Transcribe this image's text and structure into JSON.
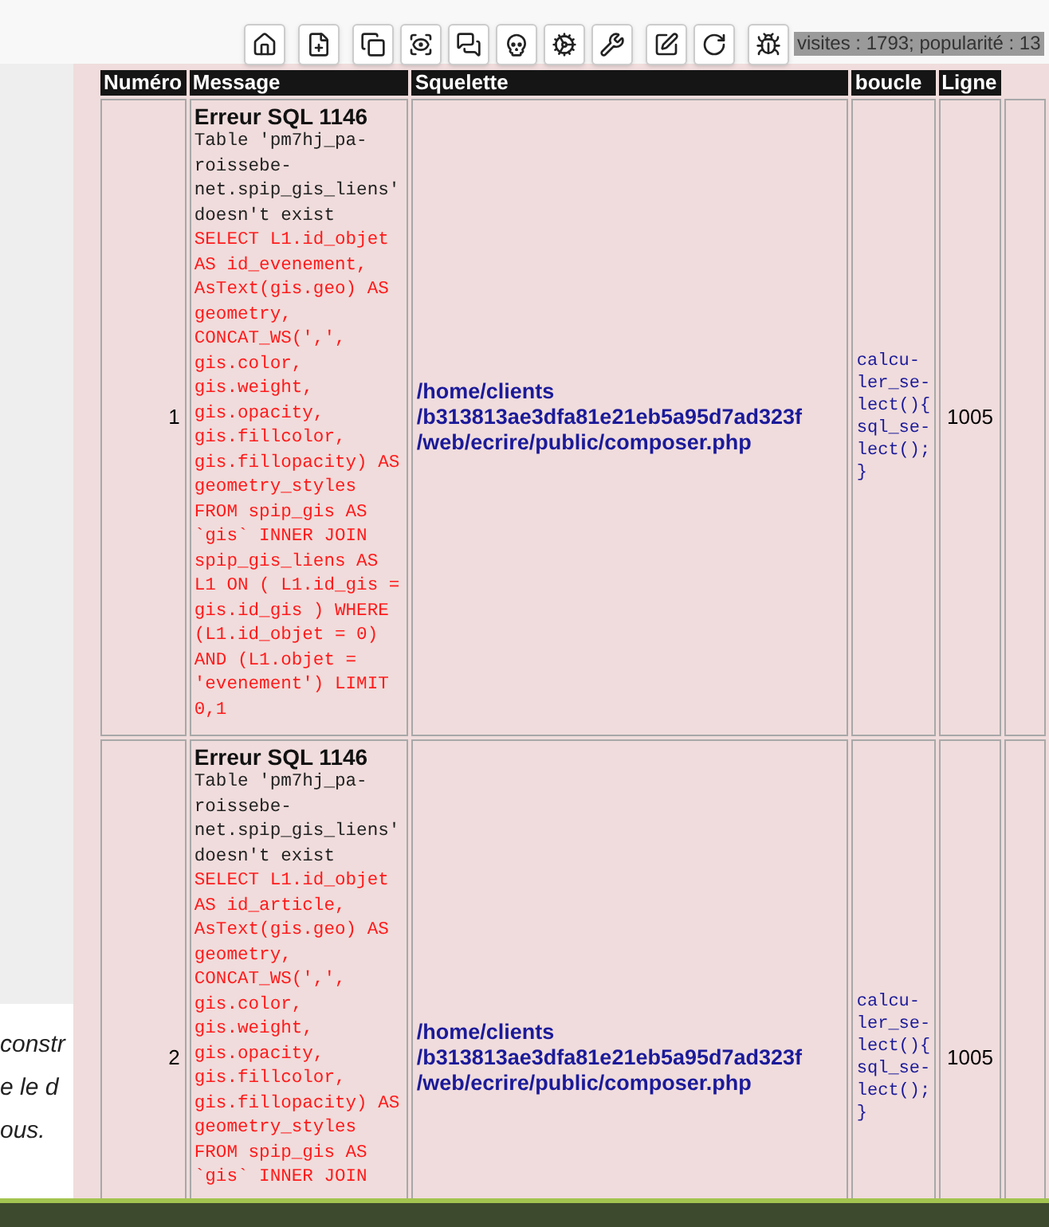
{
  "stats": "visites : 1793; popularité : 13",
  "background_text": [
    "constr",
    "e le d",
    "ous."
  ],
  "table": {
    "columns": [
      "Numéro",
      "Message",
      "Squelette",
      "boucle",
      "Ligne"
    ],
    "rows": [
      {
        "number": "1",
        "error_title": "Erreur SQL 1146",
        "error_text": "Table 'pm7hj_pa-roissebe-net.spip_gis_liens' doesn't exist",
        "query": "SELECT L1.id_objet AS id_evenement, AsText(gis.geo) AS geometry, CONCAT_WS(',', gis.color, gis.weight, gis.opacity, gis.fillcolor, gis.fillopacity) AS geometry_styles FROM spip_gis AS `gis` INNER JOIN spip_gis_liens AS L1 ON ( L1.id_gis = gis.id_gis ) WHERE (L1.id_objet = 0) AND (L1.objet = 'evenement') LIMIT 0,1",
        "path": [
          "/home/clients",
          "/b313813ae3dfa81e21eb5a95d7ad323f",
          "/web/ecrire/public/composer.php"
        ],
        "loop": [
          "calcu-",
          "ler_se-",
          "lect(){",
          "sql_se-",
          "lect();",
          "}"
        ],
        "line": "1005"
      },
      {
        "number": "2",
        "error_title": "Erreur SQL 1146",
        "error_text": "Table 'pm7hj_pa-roissebe-net.spip_gis_liens' doesn't exist",
        "query": "SELECT L1.id_objet AS id_article, AsText(gis.geo) AS geometry, CONCAT_WS(',', gis.color, gis.weight, gis.opacity, gis.fillcolor, gis.fillopacity) AS geometry_styles FROM spip_gis AS `gis` INNER JOIN",
        "path": [
          "/home/clients",
          "/b313813ae3dfa81e21eb5a95d7ad323f",
          "/web/ecrire/public/composer.php"
        ],
        "loop": [
          "calcu-",
          "ler_se-",
          "lect(){",
          "sql_se-",
          "lect();",
          "}"
        ],
        "line": "1005"
      }
    ]
  }
}
